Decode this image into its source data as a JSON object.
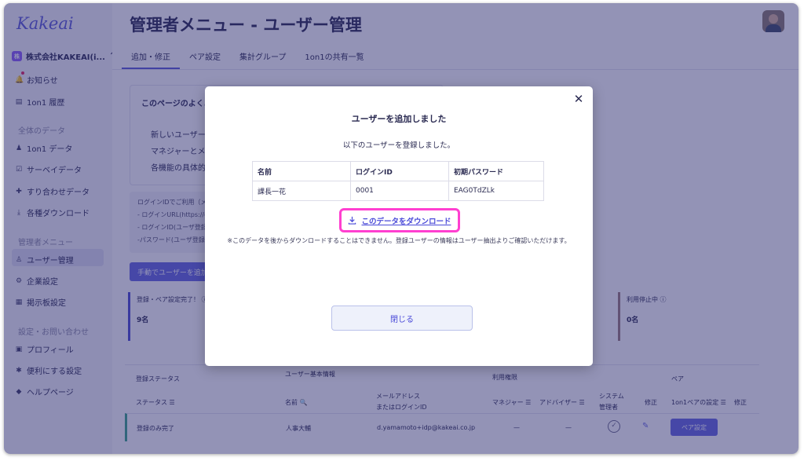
{
  "sidebar": {
    "logo": "Kakeai",
    "company": {
      "badge": "株",
      "name": "株式会社KAKEAI(i...",
      "chevron": "⌃"
    },
    "items": [
      {
        "icon": "bell-icon",
        "glyph": "🔔",
        "label": "お知らせ"
      },
      {
        "icon": "history-icon",
        "glyph": "▤",
        "label": "1on1 履歴"
      }
    ],
    "section_all": "全体のデータ",
    "data_items": [
      {
        "icon": "people-icon",
        "glyph": "♟",
        "label": "1on1 データ"
      },
      {
        "icon": "survey-icon",
        "glyph": "☑",
        "label": "サーベイデータ"
      },
      {
        "icon": "puzzle-icon",
        "glyph": "✚",
        "label": "すり合わせデータ"
      },
      {
        "icon": "download-icon",
        "glyph": "⤓",
        "label": "各種ダウンロード"
      }
    ],
    "section_admin": "管理者メニュー",
    "admin_items": [
      {
        "icon": "user-manage-icon",
        "glyph": "♙",
        "label": "ユーザー管理"
      },
      {
        "icon": "company-icon",
        "glyph": "⚙",
        "label": "企業設定"
      },
      {
        "icon": "board-icon",
        "glyph": "▦",
        "label": "掲示板設定"
      }
    ],
    "section_settings": "設定・お問い合わせ",
    "settings_items": [
      {
        "icon": "profile-icon",
        "glyph": "▣",
        "label": "プロフィール"
      },
      {
        "icon": "gear-icon",
        "glyph": "✱",
        "label": "便利にする設定"
      },
      {
        "icon": "help-icon",
        "glyph": "◆",
        "label": "ヘルプページ"
      }
    ]
  },
  "header": {
    "title": "管理者メニュー - ユーザー管理"
  },
  "tabs": [
    "追加・修正",
    "ペア設定",
    "集計グループ",
    "1on1の共有一覧"
  ],
  "faq": {
    "title": "このページのよくあ",
    "lines": [
      "新しいユーザーを",
      "マネジャーとメン",
      "各機能の具体的な"
    ]
  },
  "login_box": {
    "lines": [
      "ログインIDでご利用（メ",
      "- ログインURL(https://de",
      "- ログインID(ユーザ登録",
      "-パスワード(ユーザ登録"
    ]
  },
  "manual_button": "手動でユーザーを追加",
  "stats": [
    {
      "label": "登録・ペア設定完了！ ⓘ",
      "value": "9名"
    },
    {
      "label": "利用停止中 ⓘ",
      "value": "0名"
    }
  ],
  "table": {
    "group_status": "登録ステータス",
    "group_basic": "ユーザー基本情報",
    "group_perm": "利用権限",
    "group_pair": "ペア",
    "col_status": "ステータス ☰",
    "col_name": "名前 🔍",
    "col_mail_1": "メールアドレス",
    "col_mail_2": "またはログインID",
    "col_manager": "マネジャー ☰",
    "col_advisor": "アドバイザー ☰",
    "col_sys_1": "システム",
    "col_sys_2": "管理者",
    "col_edit": "修正",
    "col_pair_setting": "1on1ペアの設定 ☰",
    "col_pair_edit": "修正",
    "row": {
      "status": "登録のみ完了",
      "name": "人事大輔",
      "email": "d.yamamoto+idp@kakeai.co.jp",
      "manager": "—",
      "advisor": "—",
      "pair_button": "ペア設定"
    }
  },
  "modal": {
    "title": "ユーザーを追加しました",
    "subtitle": "以下のユーザーを登録しました。",
    "headers": [
      "名前",
      "ログインID",
      "初期パスワード"
    ],
    "rows": [
      [
        "課長一花",
        "0001",
        "EAG0TdZLk"
      ]
    ],
    "download_link": "このデータをダウンロード",
    "note": "※このデータを後からダウンロードすることはできません。登録ユーザーの情報はユーザー抽出よりご確認いただけます。",
    "close_button": "閉じる",
    "close_icon": "✕"
  },
  "colors": {
    "accent": "#5b5bd6",
    "highlight": "#ff3fd0",
    "overlay": "#28286e"
  }
}
